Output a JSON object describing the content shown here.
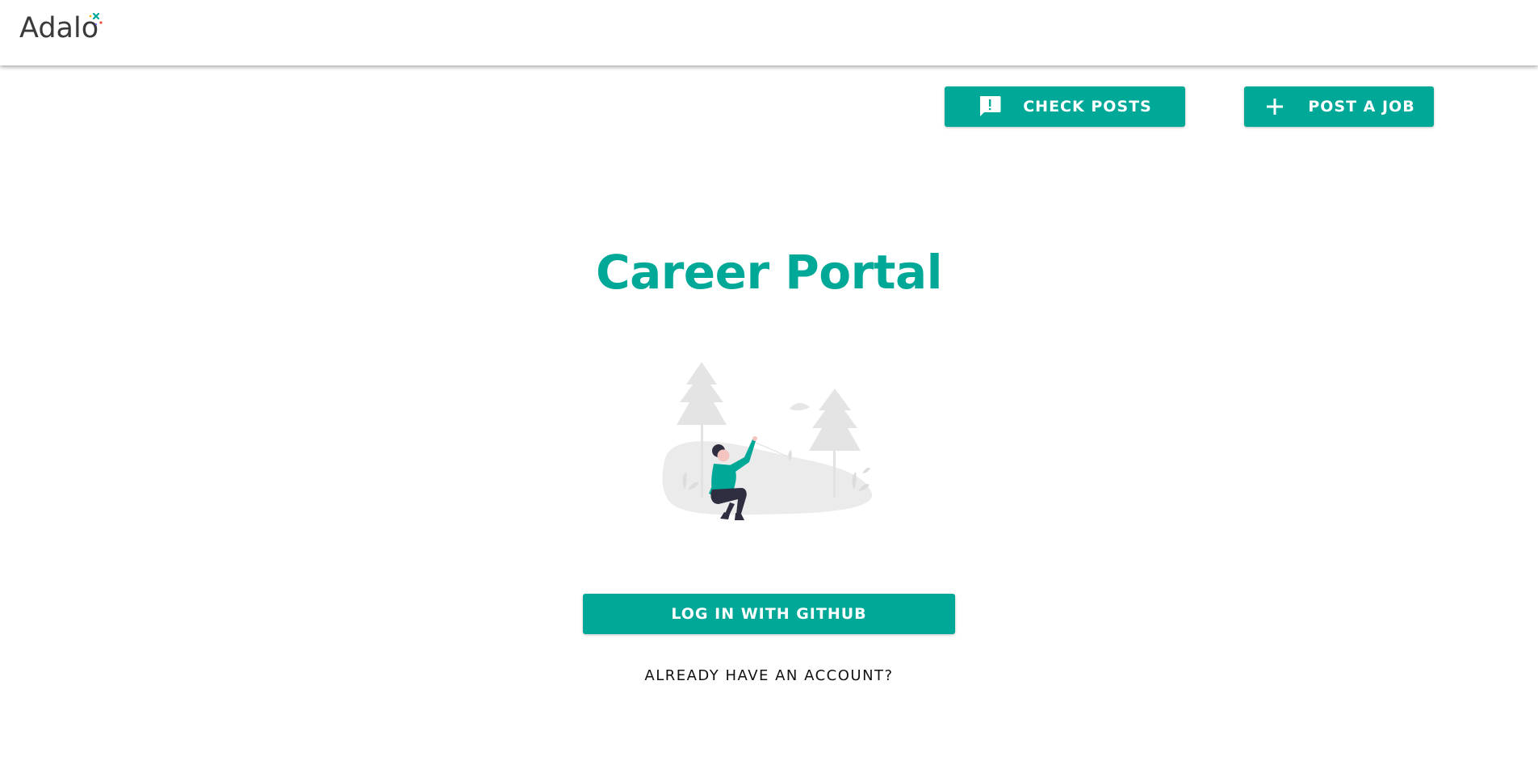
{
  "brand": {
    "logo_text": "Adalo",
    "logo_icon": "adalo-sparkle-icon"
  },
  "actions": {
    "check_posts_label": "CHECK POSTS",
    "check_posts_icon": "feedback-exclamation-icon",
    "post_job_label": "POST A JOB",
    "post_job_icon": "plus-icon"
  },
  "main": {
    "title": "Career Portal",
    "illustration": "person-sitting-in-park-illustration",
    "github_button_label": "LOG IN WITH GITHUB",
    "account_link_label": "ALREADY HAVE AN ACCOUNT?"
  },
  "colors": {
    "accent": "#00a898",
    "background": "#ffffff",
    "logo_text": "#3a3a3a"
  }
}
